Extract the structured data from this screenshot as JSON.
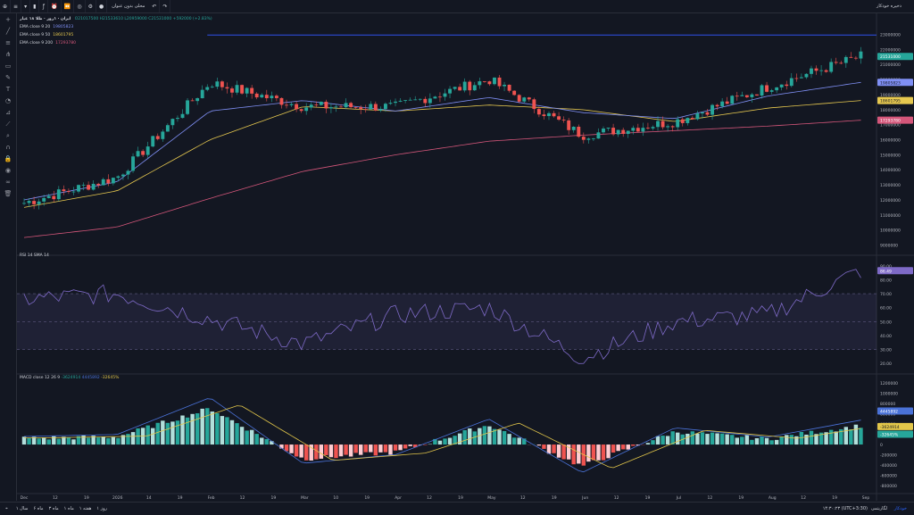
{
  "toolbar": {
    "icons": [
      "plus-icon",
      "symbol-search-icon",
      "interval-icon",
      "candle-style-icon",
      "indicators-icon",
      "alert-icon",
      "replay-icon",
      "undo-icon",
      "redo-icon",
      "camera-icon",
      "settings-icon"
    ],
    "untitled_label": "محلی بدون عنوان",
    "save_label": "ذخیره خودکار"
  },
  "legend": {
    "symbol": "ایران · ۱روز · طلا ۱۸ عیار",
    "ohlc": "O21017500 H21533610 L20959000 C21531000 +592000 (+2.83%)",
    "ema1": {
      "name": "EMA close 9 20",
      "value": "19805823"
    },
    "ema2": {
      "name": "EMA close 9 50",
      "value": "18601795"
    },
    "ema3": {
      "name": "EMA close 9 200",
      "value": "17293780"
    }
  },
  "rsi": {
    "label": "RSI 14 SMA 14",
    "value": "86.49"
  },
  "macd": {
    "label": "MACD close 12 26 9",
    "v1": "-3624914",
    "v2": "4445892",
    "v3": "-32645%"
  },
  "price_axis": {
    "ticks": [
      "23000000",
      "22000000",
      "21000000",
      "20000000",
      "19000000",
      "18000000",
      "17000000",
      "16000000",
      "15000000",
      "14000000",
      "13000000",
      "12000000",
      "11000000",
      "10000000",
      "9000000"
    ],
    "last": "21531000",
    "ema_tags": [
      "19805823",
      "18601795",
      "17293780"
    ]
  },
  "rsi_axis": {
    "ticks": [
      "90.00",
      "80.00",
      "70.00",
      "60.00",
      "50.00",
      "40.00",
      "30.00",
      "20.00"
    ]
  },
  "macd_axis": {
    "ticks": [
      "1200000",
      "1000000",
      "800000",
      "600000",
      "400000",
      "200000",
      "0",
      "-200000",
      "-400000",
      "-600000",
      "-800000"
    ],
    "tags": [
      "4445892",
      "-3624914",
      "-32645%"
    ]
  },
  "time_axis": {
    "labels": [
      "Dec",
      "12",
      "19",
      "2026",
      "14",
      "19",
      "Feb",
      "12",
      "19",
      "Mar",
      "10",
      "19",
      "Apr",
      "12",
      "19",
      "May",
      "12",
      "19",
      "Jun",
      "12",
      "19",
      "Jul",
      "12",
      "19",
      "Aug",
      "12",
      "19",
      "Sep"
    ]
  },
  "bottom": {
    "ranges": [
      "سال ۱",
      "ماه ۶",
      "ماه ۳",
      "ماه ۱",
      "هفته ۱",
      "روز ۱"
    ],
    "time": "۱۴:۳۰:۲۳ (UTC+3:30)",
    "log": "لگاریتمی",
    "auto": "خودکار"
  },
  "colors": {
    "up": "#26a69a",
    "down": "#ef5350",
    "ema20": "#7f8ff4",
    "ema50": "#e6c84f",
    "ema200": "#d4567a",
    "rsi": "#7e6ac7",
    "macd": "#4a72d8",
    "signal": "#e2c64a",
    "resistance": "#3050e8"
  },
  "chart_data": {
    "type": "candlestick",
    "x": [
      "Dec",
      "2026",
      "Feb",
      "Mar",
      "Apr",
      "May",
      "Jun",
      "Jul",
      "Aug",
      "Sep"
    ],
    "close": [
      11800000,
      13500000,
      19800000,
      18200000,
      18200000,
      20000000,
      16300000,
      17200000,
      19500000,
      21531000
    ],
    "ema20": [
      12000000,
      13200000,
      17900000,
      18600000,
      17900000,
      18800000,
      17800000,
      17400000,
      18900000,
      19805823
    ],
    "ema50": [
      11500000,
      12600000,
      16000000,
      18200000,
      17900000,
      18300000,
      18000000,
      17200000,
      18100000,
      18601795
    ],
    "ema200": [
      9500000,
      10200000,
      12100000,
      13900000,
      15000000,
      15900000,
      16300000,
      16600000,
      16900000,
      17293780
    ],
    "resistance": 22950000,
    "rsi": [
      66,
      70,
      52,
      34,
      55,
      60,
      24,
      50,
      55,
      86.49
    ],
    "macd_hist": [
      120000,
      150000,
      700000,
      -280000,
      -150000,
      380000,
      -420000,
      250000,
      110000,
      365000
    ]
  }
}
